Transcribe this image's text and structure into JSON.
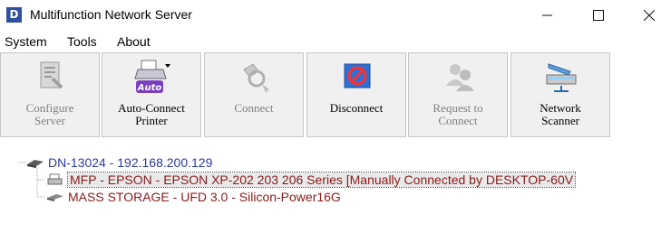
{
  "window": {
    "title": "Multifunction Network Server",
    "app_icon_letter": "D"
  },
  "menu": [
    "System",
    "Tools",
    "About"
  ],
  "toolbar": [
    {
      "label": "Configure\nServer",
      "icon": "configure-server-icon",
      "enabled": false
    },
    {
      "label": "Auto-Connect\nPrinter",
      "icon": "auto-connect-printer-icon",
      "enabled": true
    },
    {
      "label": "Connect",
      "icon": "connect-icon",
      "enabled": false
    },
    {
      "label": "Disconnect",
      "icon": "disconnect-icon",
      "enabled": true
    },
    {
      "label": "Request to\nConnect",
      "icon": "request-connect-icon",
      "enabled": false
    },
    {
      "label": "Network\nScanner",
      "icon": "network-scanner-icon",
      "enabled": true
    }
  ],
  "auto_badge": "Auto",
  "tree": {
    "root": "DN-13024 - 192.168.200.129",
    "children": [
      "MFP - EPSON - EPSON XP-202 203 206 Series [Manually Connected by DESKTOP-60V",
      "MASS STORAGE - UFD 3.0 - Silicon-Power16G"
    ]
  },
  "colors": {
    "root_text": "#2a3aa8",
    "child_text": "#8b1a1a",
    "toolbar_bg": "#f0f0f0"
  }
}
